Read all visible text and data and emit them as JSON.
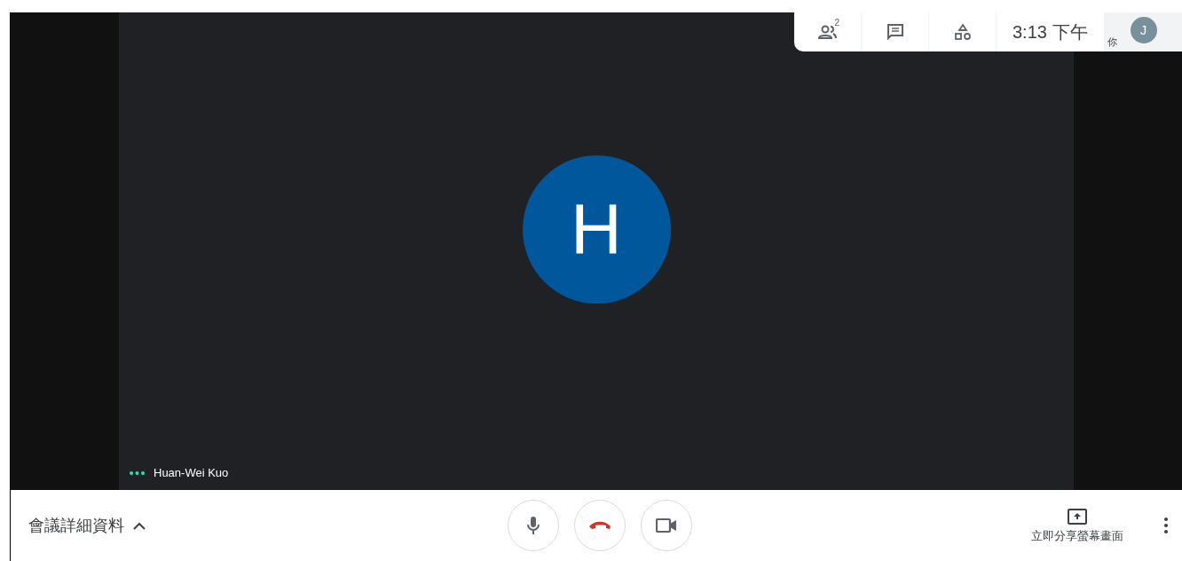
{
  "top_bar": {
    "participants_count": "2",
    "time": "3:13",
    "period": "下午",
    "self_label": "你",
    "self_initial": "J"
  },
  "stage": {
    "initial": "H",
    "name": "Huan-Wei Kuo"
  },
  "bottom_bar": {
    "details": "會議詳細資料",
    "share": "立即分享螢幕畫面"
  }
}
